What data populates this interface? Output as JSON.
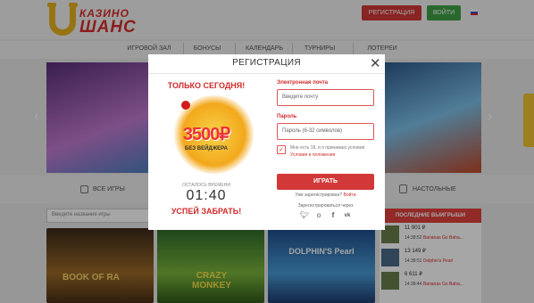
{
  "header": {
    "logo_top": "КАЗИНО",
    "logo_bottom": "ШАНС",
    "register_label": "РЕГИСТРАЦИЯ",
    "login_label": "ВОЙТИ"
  },
  "nav": {
    "items": [
      {
        "label": "ИГРОВОЙ ЗАЛ"
      },
      {
        "label": "БОНУСЫ"
      },
      {
        "label": "КАЛЕНДАРЬ"
      },
      {
        "label": "ТУРНИРЫ"
      },
      {
        "label": "ЛОТЕРЕИ"
      }
    ]
  },
  "categories": {
    "all_games": "ВСЕ ИГРЫ",
    "table_games": "НАСТОЛЬНЫЕ"
  },
  "search": {
    "placeholder": "Введите название игры"
  },
  "winners": {
    "title": "ПОСЛЕДНИЕ ВЫИГРЫШИ",
    "rows": [
      {
        "amount": "11 901 ₽",
        "time": "14:38:52",
        "game": "Bananas Go Baha..."
      },
      {
        "amount": "13 149 ₽",
        "time": "14:38:51",
        "game": "Dolphin's Pearl"
      },
      {
        "amount": "6 611 ₽",
        "time": "14:38:44",
        "game": "Bananas Go Baha..."
      }
    ]
  },
  "games": [
    {
      "title": "BOOK OF RA"
    },
    {
      "title": "CRAZY MONKEY"
    },
    {
      "title": "DOLPHIN'S Pearl"
    }
  ],
  "modal": {
    "title": "РЕГИСТРАЦИЯ",
    "promo_headline": "ТОЛЬКО СЕГОДНЯ!",
    "promo_amount": "3500₽",
    "promo_sub": "БЕЗ ВЕЙДЖЕРА",
    "time_left_label": "ОСТАЛОСЬ ВРЕМЕНИ",
    "timer": "01:40",
    "hurry": "УСПЕЙ ЗАБРАТЬ!",
    "email_label": "Электронная почта",
    "email_placeholder": "Введите почту",
    "password_label": "Пароль",
    "password_placeholder": "Пароль (6-32 символов)",
    "checkbox_mark": "✓",
    "terms_text": "Мне есть 18, и я принимаю условия",
    "terms_link": "Условия и положения",
    "play_label": "ИГРАТЬ",
    "already_text": "Уже зарегистрирован?",
    "already_link": "Войти",
    "via_text": "Зарегистрироваться через"
  },
  "colors": {
    "accent_red": "#d23838",
    "accent_green": "#3ea046",
    "logo_gold": "#e8b21e"
  },
  "icons": [
    "close-icon",
    "twitter-icon",
    "odnoklassniki-icon",
    "facebook-icon",
    "vk-icon",
    "chevron-left-icon",
    "chevron-right-icon",
    "flag-ru-icon",
    "dice-icon",
    "cards-icon"
  ]
}
